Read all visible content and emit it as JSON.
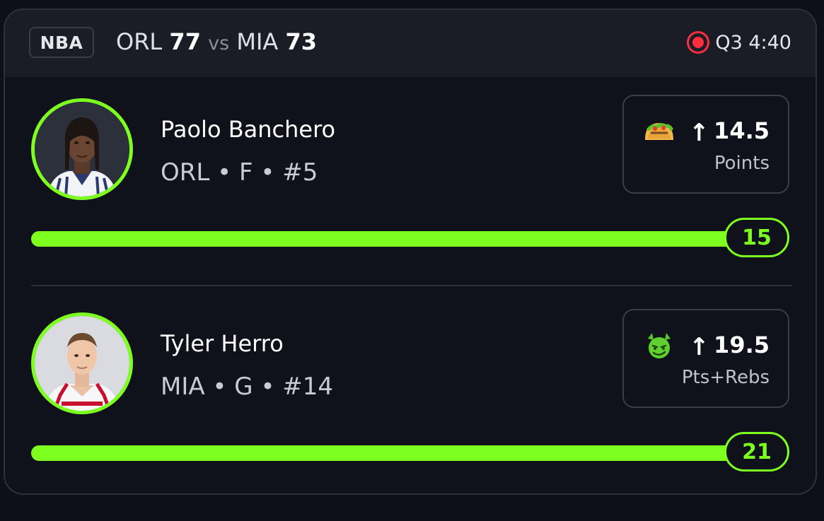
{
  "header": {
    "league": "NBA",
    "away_team": "ORL",
    "away_score": "77",
    "vs": "vs",
    "home_team": "MIA",
    "home_score": "73",
    "game_clock": "Q3 4:40",
    "live_color": "#ff2d3d"
  },
  "players": [
    {
      "name": "Paolo Banchero",
      "meta": "ORL • F • #5",
      "pick_icon": "taco-icon",
      "direction_icon": "arrow-up-icon",
      "line": "14.5",
      "stat": "Points",
      "current": "15",
      "progress": 1.0
    },
    {
      "name": "Tyler Herro",
      "meta": "MIA • G • #14",
      "pick_icon": "green-devil-face-icon",
      "direction_icon": "arrow-up-icon",
      "line": "19.5",
      "stat": "Pts+Rebs",
      "current": "21",
      "progress": 1.0
    }
  ],
  "colors": {
    "accent": "#7dff1f",
    "background": "#0e1019",
    "card": "#10121b"
  }
}
